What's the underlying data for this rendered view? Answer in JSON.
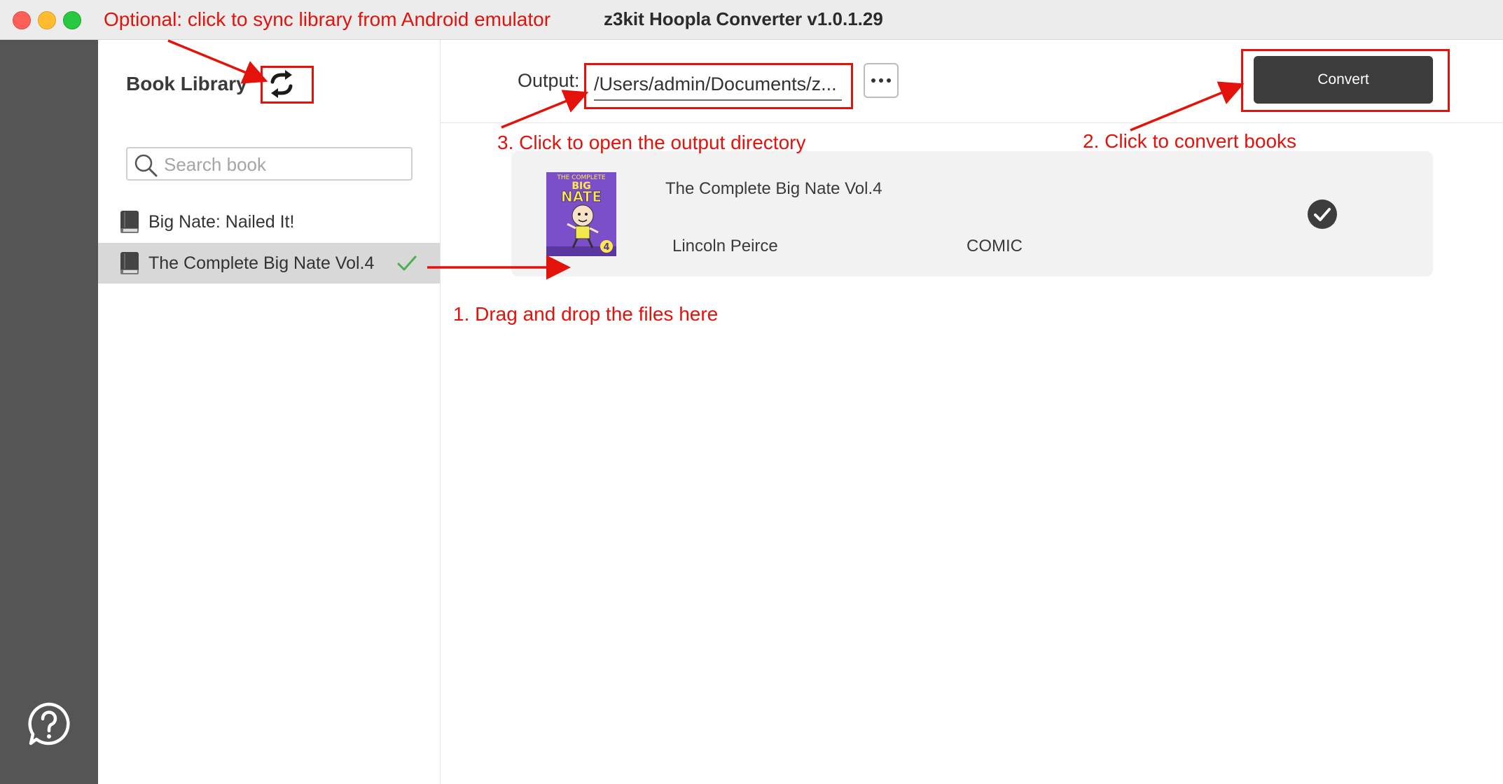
{
  "window": {
    "title": "z3kit Hoopla Converter v1.0.1.29"
  },
  "library": {
    "title": "Book Library",
    "search_placeholder": "Search book",
    "items": [
      {
        "label": "Big Nate: Nailed It!",
        "selected": false
      },
      {
        "label": "The Complete Big Nate Vol.4",
        "selected": true
      }
    ]
  },
  "output": {
    "label": "Output:",
    "path": "/Users/admin/Documents/z..."
  },
  "toolbar": {
    "convert_label": "Convert"
  },
  "book": {
    "title": "The Complete Big Nate Vol.4",
    "author": "Lincoln Peirce",
    "type": "COMIC",
    "cover_top_text": "THE COMPLETE",
    "cover_mid_text": "BIG",
    "cover_main_text": "NATE",
    "cover_number": "4"
  },
  "annotations": {
    "sync": "Optional: click to sync library from Android emulator",
    "output": "3. Click to open the output directory",
    "convert": "2. Click to convert books",
    "drag": "1. Drag and drop the files here"
  },
  "colors": {
    "annotation": "#e3120b",
    "rail": "#555555",
    "convert_button": "#3c3c3c",
    "card": "#f2f2f2",
    "selected_row": "#d8d8d8",
    "checkmark": "#4caf50"
  }
}
